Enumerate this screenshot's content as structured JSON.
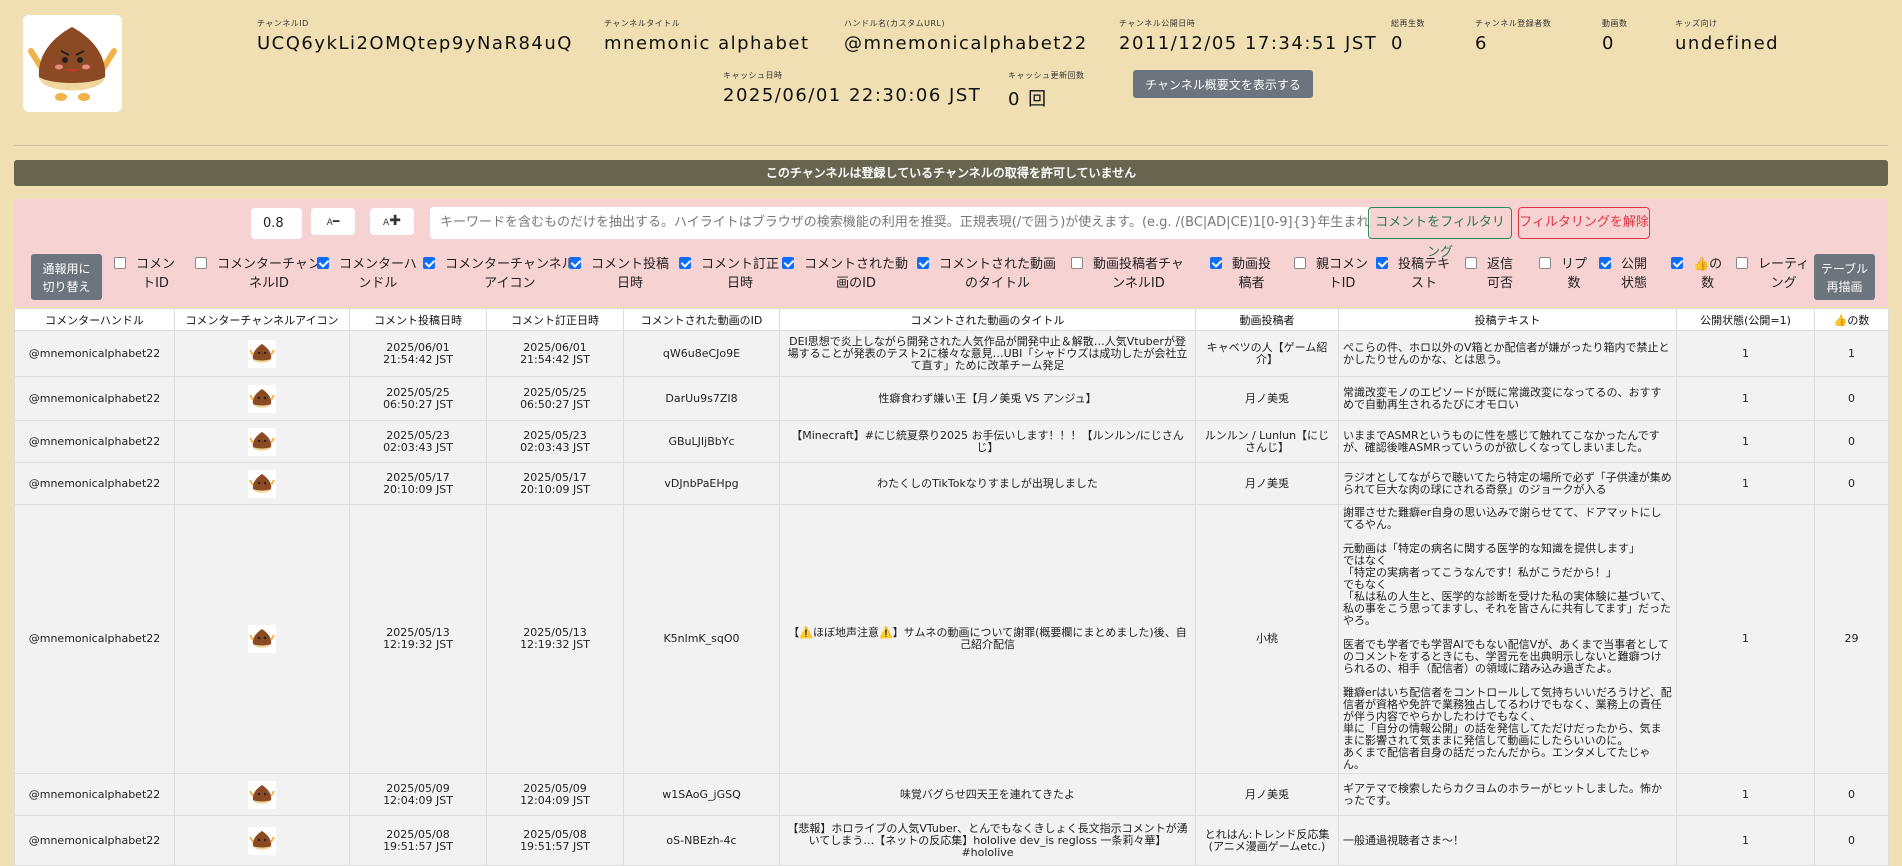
{
  "header": {
    "channel_id": {
      "label": "チャンネルID",
      "value": "UCQ6ykLi2OMQtep9yNaR84uQ"
    },
    "channel_title": {
      "label": "チャンネルタイトル",
      "value": "mnemonic alphabet"
    },
    "handle": {
      "label": "ハンドル名(カスタムURL)",
      "value": "@mnemonicalphabet22"
    },
    "published": {
      "label": "チャンネル公開日時",
      "value": "2011/12/05 17:34:51 JST"
    },
    "total_views": {
      "label": "総再生数",
      "value": "0"
    },
    "subscribers": {
      "label": "チャンネル登録者数",
      "value": "6"
    },
    "videos": {
      "label": "動画数",
      "value": "0"
    },
    "for_kids": {
      "label": "キッズ向け",
      "value": "undefined"
    },
    "cache_date": {
      "label": "キャッシュ日時",
      "value": "2025/06/01 22:30:06 JST"
    },
    "cache_count": {
      "label": "キャッシュ更新回数",
      "value": "0 回"
    },
    "desc_button": "チャンネル概要文を表示する"
  },
  "banner": "このチャンネルは登録しているチャンネルの取得を許可していません",
  "toolbar": {
    "zoom": "0.8",
    "zoom_out": "A",
    "zoom_in": "A",
    "keyword_placeholder": "キーワードを含むものだけを抽出する。ハイライトはブラウザの検索機能の利用を推奨。正規表現(/で囲う)が使えます。(e.g. /(BC|AD|CE)1[0-9]{3}年生まれ/i )",
    "filter_button": "コメントをフィルタリング",
    "clear_button": "フィルタリングを解除",
    "toggle_button": "通報用に\n切り替え",
    "redraw_button": "テーブル\n再描画",
    "columns": [
      {
        "label": "コメン\nトID",
        "checked": false
      },
      {
        "label": "コメンターチャン\nネルID",
        "checked": false
      },
      {
        "label": "コメンターハ\nンドル",
        "checked": true
      },
      {
        "label": "コメンターチャンネル\nアイコン",
        "checked": true
      },
      {
        "label": "コメント投稿\n日時",
        "checked": true
      },
      {
        "label": "コメント訂正\n日時",
        "checked": true
      },
      {
        "label": "コメントされた動\n画のID",
        "checked": true
      },
      {
        "label": "コメントされた動画\nのタイトル",
        "checked": true
      },
      {
        "label": "動画投稿者チャ\nンネルID",
        "checked": false
      },
      {
        "label": "動画投\n稿者",
        "checked": true
      },
      {
        "label": "親コメン\nトID",
        "checked": false
      },
      {
        "label": "投稿テキ\nスト",
        "checked": true
      },
      {
        "label": "返信\n可否",
        "checked": false
      },
      {
        "label": "リプ\n数",
        "checked": false
      },
      {
        "label": "公開\n状態",
        "checked": true
      },
      {
        "label": "👍の\n数",
        "checked": true
      },
      {
        "label": "レーティ\nング",
        "checked": false
      }
    ]
  },
  "table": {
    "headers": [
      "コメンターハンドル",
      "コメンターチャンネルアイコン",
      "コメント投稿日時",
      "コメント訂正日時",
      "コメントされた動画のID",
      "コメントされた動画のタイトル",
      "動画投稿者",
      "投稿テキスト",
      "公開状態(公開=1)",
      "👍の数"
    ],
    "rows": [
      {
        "handle": "@mnemonicalphabet22",
        "posted": "2025/06/01\n21:54:42 JST",
        "edited": "2025/06/01\n21:54:42 JST",
        "video_id": "qW6u8eCJo9E",
        "title": "DEI思想で炎上しながら開発された人気作品が開発中止＆解散…人気Vtuberが登場することが発表のテスト2に様々な意見…UBI「シャドウズは成功したが会社立て直す」ために改革チーム発足",
        "uploader": "キャベツの人【ゲーム紹介】",
        "text": "ぺこらの件、ホロ以外のV箱とか配信者が嫌がったり箱内で禁止とかしたりせんのかな、とは思う。",
        "public": "1",
        "likes": "1"
      },
      {
        "handle": "@mnemonicalphabet22",
        "posted": "2025/05/25\n06:50:27 JST",
        "edited": "2025/05/25\n06:50:27 JST",
        "video_id": "DarUu9s7ZI8",
        "title": "性癖食わず嫌い王【月ノ美兎 VS アンジュ】",
        "uploader": "月ノ美兎",
        "text": "常識改変モノのエピソードが既に常識改変になってるの、おすすめで自動再生されるたびにオモロい",
        "public": "1",
        "likes": "0"
      },
      {
        "handle": "@mnemonicalphabet22",
        "posted": "2025/05/23\n02:03:43 JST",
        "edited": "2025/05/23\n02:03:43 JST",
        "video_id": "GBuLJIjBbYc",
        "title": "【Minecraft】#にじ統夏祭り2025 お手伝いします！！！【ルンルン/にじさんじ】",
        "uploader": "ルンルン / Lunlun【にじさんじ】",
        "text": "いままでASMRというものに性を感じて触れてこなかったんですが、確認後唯ASMRっていうのが欲しくなってしまいました。",
        "public": "1",
        "likes": "0"
      },
      {
        "handle": "@mnemonicalphabet22",
        "posted": "2025/05/17\n20:10:09 JST",
        "edited": "2025/05/17\n20:10:09 JST",
        "video_id": "vDJnbPaEHpg",
        "title": "わたくしのTikTokなりすましが出現しました",
        "uploader": "月ノ美兎",
        "text": "ラジオとしてながらで聴いてたら特定の場所で必ず「子供達が集められて巨大な肉の球にされる奇祭」のジョークが入る",
        "public": "1",
        "likes": "0"
      },
      {
        "handle": "@mnemonicalphabet22",
        "posted": "2025/05/13\n12:19:32 JST",
        "edited": "2025/05/13\n12:19:32 JST",
        "video_id": "K5nlmK_sqO0",
        "title": "【⚠️ほぼ地声注意⚠️】サムネの動画について謝罪(概要欄にまとめました)後、自己紹介配信",
        "uploader": "小桃",
        "text": "謝罪させた難癖er自身の思い込みで謝らせてて、ドアマットにしてるやん。\n\n元動画は「特定の病名に関する医学的な知識を提供します」\nではなく\n「特定の実病者ってこうなんです！私がこうだから！」\nでもなく\n「私は私の人生と、医学的な診断を受けた私の実体験に基づいて、私の事をこう思ってますし、それを皆さんに共有してます」だったやろ。\n\n医者でも学者でも学習AIでもない配信Vが、あくまで当事者としてのコメントをするときにも、学習元を出典明示しないと難癖つけられるの、相手（配信者）の領域に踏み込み過ぎたよ。\n\n難癖erはいち配信者をコントロールして気持ちいいだろうけど、配信者が資格や免許で業務独占してるわけでもなく、業務上の責任が伴う内容でやらかしたわけでもなく、\n単に「自分の情報公開」の話を発信してただけだったから、気ままに影響されて気ままに発信して動画にしたらいいのに。\nあくまで配信者自身の話だったんだから。エンタメしてたじゃん。",
        "public": "1",
        "likes": "29"
      },
      {
        "handle": "@mnemonicalphabet22",
        "posted": "2025/05/09\n12:04:09 JST",
        "edited": "2025/05/09\n12:04:09 JST",
        "video_id": "w1SAoG_jGSQ",
        "title": "味覚バグらせ四天王を連れてきたよ",
        "uploader": "月ノ美兎",
        "text": "ギアテマで検索したらカクヨムのホラーがヒットしました。怖かったです。",
        "public": "1",
        "likes": "0"
      },
      {
        "handle": "@mnemonicalphabet22",
        "posted": "2025/05/08\n19:51:57 JST",
        "edited": "2025/05/08\n19:51:57 JST",
        "video_id": "oS-NBEzh-4c",
        "title": "【悲報】ホロライブの人気VTuber、とんでもなくきしょく長文指示コメントが湧いてしまう…【ネットの反応集】hololive dev_is regloss 一条莉々華】#hololive",
        "uploader": "とれはん:トレンド反応集(アニメ漫画ゲームetc.)",
        "text": "一般通過視聴者さま〜！",
        "public": "1",
        "likes": "0"
      }
    ]
  },
  "colors": {
    "background": "#efdfb3",
    "banner": "#67644f",
    "toolbar": "#f7d2d2",
    "accent_blue": "#0d6efd",
    "filter_green": "#2f8a5b",
    "clear_red": "#dc3545"
  }
}
